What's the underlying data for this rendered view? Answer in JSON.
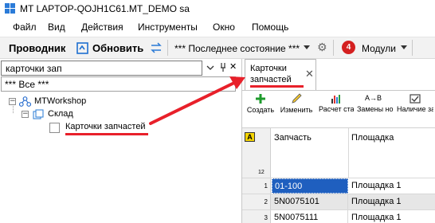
{
  "titlebar": {
    "title": "MT LAPTOP-QOJH1C61.MT_DEMO sa"
  },
  "menu": {
    "items": [
      "Файл",
      "Вид",
      "Действия",
      "Инструменты",
      "Окно",
      "Помощь"
    ]
  },
  "toolbar": {
    "explorer_label": "Проводник",
    "refresh_label": "Обновить",
    "state_label": "*** Последнее состояние ***",
    "notification_count": "4",
    "modules_label": "Модули"
  },
  "left_panel": {
    "search_value": "карточки зап",
    "filter_value": "*** Все ***",
    "pin_glyph": " ꟷ",
    "close_glyph": "✕"
  },
  "tree": {
    "root": "MTWorkshop",
    "child": "Склад",
    "leaf": "Карточки запчастей",
    "expand_glyph": "−"
  },
  "doc_tab": {
    "title": "Карточки запчастей",
    "close_glyph": "✕"
  },
  "doc_toolbar": {
    "buttons": [
      {
        "label": "Создать"
      },
      {
        "label": "Изменить"
      },
      {
        "label": "Расчет статисти..."
      },
      {
        "label": "Замены номеров..."
      },
      {
        "label": "Наличие запчасти"
      }
    ],
    "replace_icon_text": "A→B"
  },
  "grid": {
    "corner_label": "A",
    "count": "12",
    "columns": [
      "Запчасть",
      "Площадка"
    ],
    "rows": [
      {
        "num": "1",
        "part": "01-100",
        "site": "Площадка 1"
      },
      {
        "num": "2",
        "part": "5N0075101",
        "site": "Площадка 1"
      },
      {
        "num": "3",
        "part": "5N0075111",
        "site": "Площадка 1"
      }
    ]
  },
  "colors": {
    "accent": "#1e5fc1",
    "annotation": "#e8202a",
    "selected_row": "#1f5fbf",
    "badge": "#d42020"
  }
}
